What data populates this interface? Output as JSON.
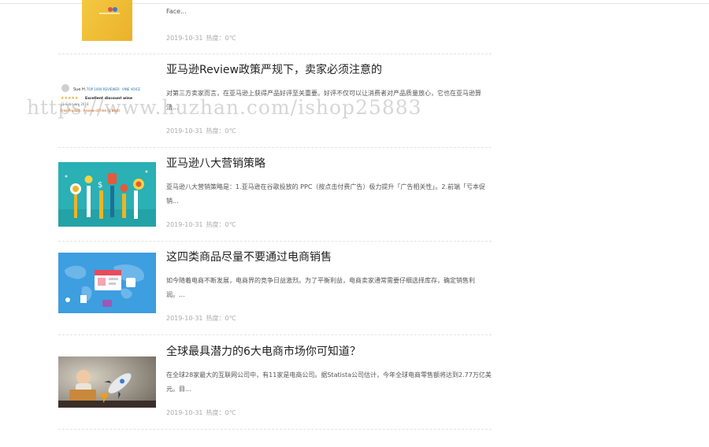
{
  "articles": [
    {
      "title": "",
      "excerpt": "Face...",
      "date": "2019-10-31",
      "heat_label": "热度：",
      "heat_value": "0℃",
      "thumb_icon": "yellow-card-image"
    },
    {
      "title": "亚马逊Review政策严规下，卖家必须注意的",
      "excerpt": "对第三方卖家而言，在亚马逊上获得产品好评至关重要。好评不仅可以让消费者对产品质量放心，它也在亚马逊算法...",
      "date": "2019-10-31",
      "heat_label": "热度：",
      "heat_value": "0℃",
      "thumb_icon": "review-screenshot-image",
      "thumb_text": {
        "reviewer": "Sue H.",
        "badge": "TOP 1000 REVIEWER",
        "vine": "VINE VOICE",
        "rating_title": "Excellent discount wine",
        "date": "11 February 2018",
        "verified": "Free Product · Review of Free (1 Best)"
      }
    },
    {
      "title": "亚马逊八大营销策略",
      "excerpt": "亚马逊八大营销策略是：1.亚马逊在谷歌投放的 PPC（按点击付费广告）极力提升「广告相关性」。2.前端「亏本促销...",
      "date": "2019-10-31",
      "heat_label": "热度：",
      "heat_value": "0℃",
      "thumb_icon": "marketing-pencils-image"
    },
    {
      "title": "这四类商品尽量不要通过电商销售",
      "excerpt": "如今随着电商不断发展，电商界的竞争日益激烈。为了平衡利益，电商卖家通常需要仔细选择库存，确定销售利润。...",
      "date": "2019-10-31",
      "heat_label": "热度：",
      "heat_value": "0℃",
      "thumb_icon": "ecommerce-map-image"
    },
    {
      "title": "全球最具潜力的6大电商市场你可知道？",
      "excerpt": "在全球28家最大的互联网公司中，有11家是电商公司。据Statista公司估计，今年全球电商零售额将达到2.77万亿美元。目...",
      "date": "2019-10-31",
      "heat_label": "热度：",
      "heat_value": "0℃",
      "thumb_icon": "rocket-laptop-image"
    }
  ],
  "next_title_partial": "…………………………",
  "watermark": "https://www.huzhan.com/ishop25883"
}
